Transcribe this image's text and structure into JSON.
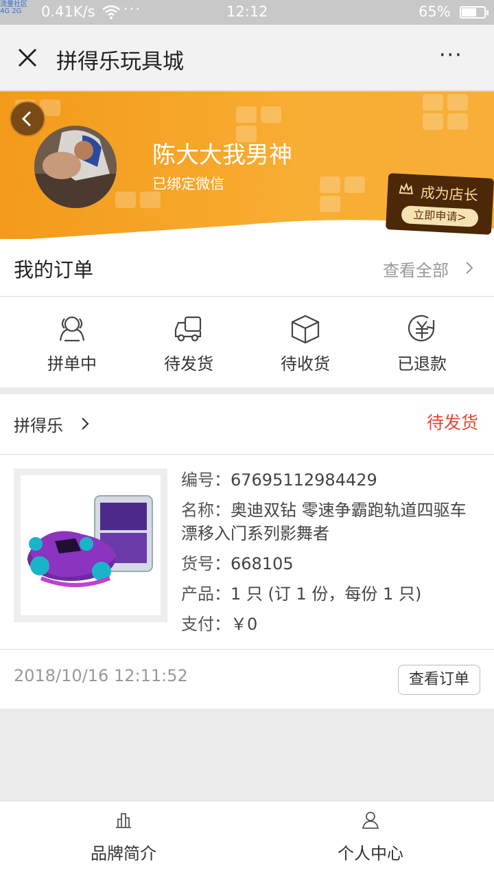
{
  "status_bar": {
    "carrier": "流量社区",
    "net": "4G 2G",
    "speed": "0.41K/s",
    "dots": "···",
    "time": "12:12",
    "battery": "65%",
    "battery_level": 0.65
  },
  "nav": {
    "title": "拼得乐玩具城",
    "more": "···"
  },
  "profile": {
    "username": "陈大大我男神",
    "bind_status": "已绑定微信",
    "shop_badge_label": "成为店长",
    "shop_badge_action": "立即申请>"
  },
  "orders": {
    "title": "我的订单",
    "view_all": "查看全部",
    "statuses": [
      {
        "label": "拼单中",
        "icon": "group-icon"
      },
      {
        "label": "待发货",
        "icon": "truck-icon"
      },
      {
        "label": "待收货",
        "icon": "box-icon"
      },
      {
        "label": "已退款",
        "icon": "refund-icon"
      }
    ]
  },
  "order": {
    "store": "拼得乐",
    "state": "待发货",
    "number_label": "编号：",
    "number": "67695112984429",
    "name_label": "名称：",
    "name": "奥迪双钻 零速争霸跑轨道四驱车 漂移入门系列影舞者",
    "sku_label": "货号：",
    "sku": "668105",
    "product_label": "产品：",
    "product": "1 只 (订 1 份，每份 1 只)",
    "pay_label": "支付：",
    "pay": "￥0",
    "time": "2018/10/16 12:11:52",
    "view_button": "查看订单"
  },
  "tabbar": {
    "items": [
      {
        "label": "品牌简介",
        "icon": "brand-icon"
      },
      {
        "label": "个人中心",
        "icon": "person-icon"
      }
    ]
  },
  "colors": {
    "accent": "#f39a1a",
    "status_red": "#ee4433"
  }
}
